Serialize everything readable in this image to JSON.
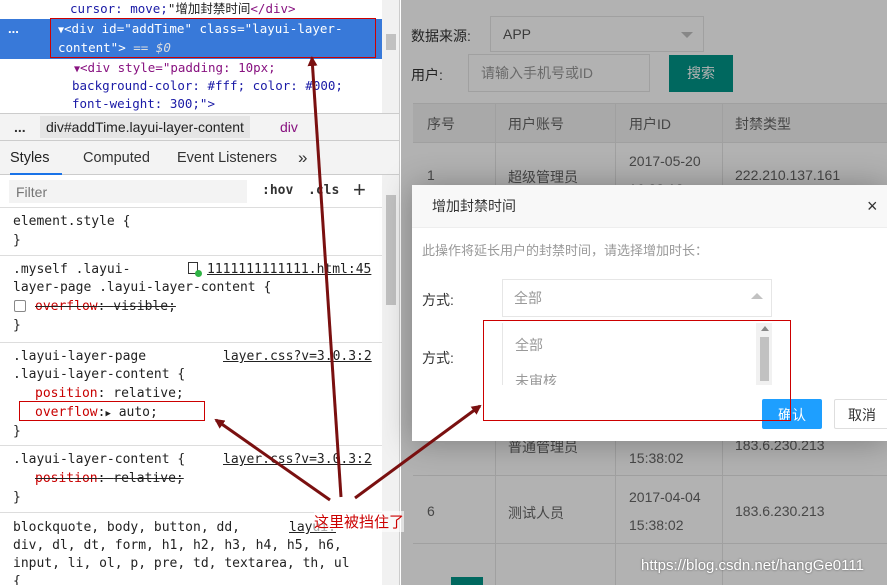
{
  "devtools": {
    "elements": {
      "line0": {
        "prop": "cursor: move;",
        "text": "增加封禁时间",
        "close": "</div>"
      },
      "selected": {
        "dots": "...",
        "row1": "<div id=\"addTime\" class=\"layui-layer-",
        "row2": "content\">",
        "row2b": " == $0"
      },
      "child": {
        "row1": "<div style=\"padding: 10px;",
        "row2": "background-color: #fff; color: #000;",
        "row3": "font-weight: 300;\">"
      }
    },
    "breadcrumb": {
      "dots": "...",
      "node": "div#addTime.layui-layer-content",
      "next": "div"
    },
    "tabs": [
      "Styles",
      "Computed",
      "Event Listeners",
      "»"
    ],
    "filter": {
      "placeholder": "Filter",
      "hov": ":hov",
      "cls": ".cls",
      "plus": "+"
    },
    "rules": {
      "element_style": {
        "selector": "element.style {",
        "close": "}"
      },
      "myself": {
        "sel1": ".myself .layui-",
        "sel2": "layer-page .layui-layer-content {",
        "source": "1111111111111.html:45",
        "prop": "overflow",
        "value": "visible;",
        "close": "}"
      },
      "layer_page": {
        "sel1": ".layui-layer-page",
        "sel2": ".layui-layer-content {",
        "source": "layer.css?v=3.0.3:2",
        "prop1": "position",
        "value1": "relative;",
        "prop2": "overflow",
        "value2": "auto;",
        "close": "}"
      },
      "layer_content": {
        "sel": ".layui-layer-content {",
        "source": "layer.css?v=3.0.3:2",
        "prop": "position",
        "value": "relative;",
        "close": "}"
      },
      "blockquote": {
        "line1": "blockquote, body, button, dd,",
        "source": "layui.",
        "line2": "div, dl, dt, form, h1, h2, h3, h4, h5, h6,",
        "line3": "input, li, ol, p, pre, td, textarea, th, ul",
        "line4": "{"
      }
    }
  },
  "webpage": {
    "source_label": "数据来源:",
    "source_value": "APP",
    "user_label": "用户:",
    "user_placeholder": "请输入手机号或ID",
    "search_button": "搜索",
    "table": {
      "headers": [
        "序号",
        "用户账号",
        "用户ID",
        "封禁类型"
      ],
      "rows": [
        {
          "no": "1",
          "account": "超级管理员",
          "date": "2017-05-20",
          "time": "16:38:12",
          "ip": "222.210.137.161"
        },
        {
          "no": "",
          "account": "普通管理员",
          "date": "",
          "time": "15:38:02",
          "ip": "183.6.230.213"
        },
        {
          "no": "6",
          "account": "测试人员",
          "date": "2017-04-04",
          "time": "15:38:02",
          "ip": "183.6.230.213"
        }
      ]
    }
  },
  "dialog": {
    "title": "增加封禁时间",
    "close": "×",
    "hint": "此操作将延长用户的封禁时间，请选择增加时长：",
    "method_label": "方式:",
    "method_value": "全部",
    "method2_label": "方式:",
    "options": [
      "全部",
      "未审核"
    ],
    "ok": "确认",
    "cancel": "取消"
  },
  "annotation": "这里被挡住了",
  "watermark": "https://blog.csdn.net/hangGe0111",
  "colors": {
    "selection": "#3879d9",
    "annotation": "#c00000",
    "arrow": "#7a1010",
    "search_button": "#009688",
    "ok_button": "#1e9fff"
  }
}
